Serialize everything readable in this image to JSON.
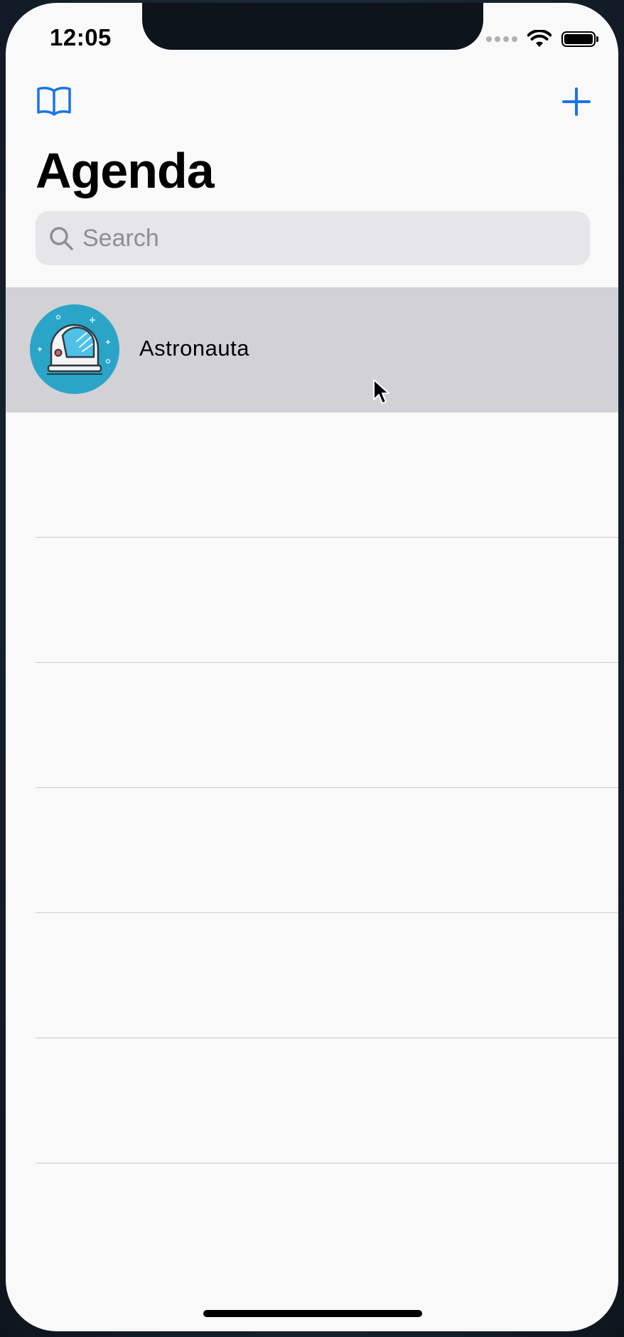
{
  "status_bar": {
    "time": "12:05"
  },
  "nav": {
    "title": "Agenda"
  },
  "search": {
    "placeholder": "Search"
  },
  "contacts": [
    {
      "name": "Astronauta"
    }
  ],
  "empty_rows": 6,
  "colors": {
    "accent": "#1a73e8",
    "avatar_bg": "#2aa5c7",
    "selected_row": "#d1d1d6"
  },
  "icons": {
    "left": "book-icon",
    "right": "plus-icon",
    "search": "search-icon"
  }
}
